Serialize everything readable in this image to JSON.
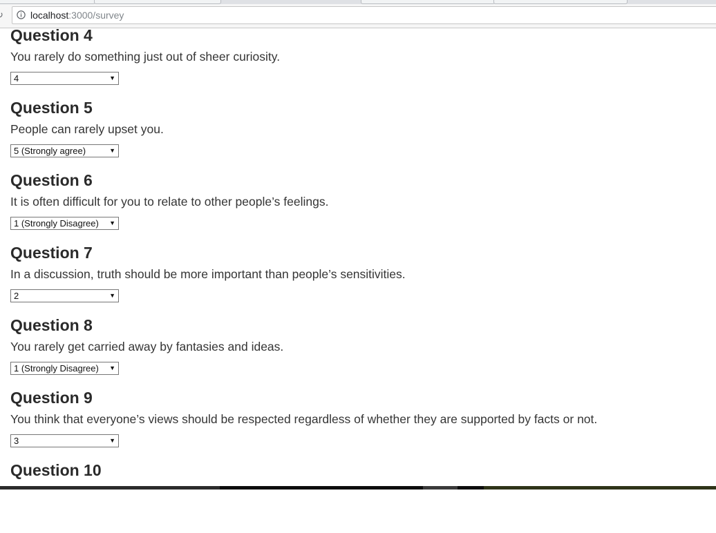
{
  "browser": {
    "url_host": "localhost",
    "url_path": ":3000/survey"
  },
  "questions": [
    {
      "title": "Question 4",
      "text": "You rarely do something just out of sheer curiosity.",
      "selected": "4"
    },
    {
      "title": "Question 5",
      "text": "People can rarely upset you.",
      "selected": "5 (Strongly agree)"
    },
    {
      "title": "Question 6",
      "text": "It is often difficult for you to relate to other people’s feelings.",
      "selected": "1 (Strongly Disagree)"
    },
    {
      "title": "Question 7",
      "text": "In a discussion, truth should be more important than people’s sensitivities.",
      "selected": "2"
    },
    {
      "title": "Question 8",
      "text": "You rarely get carried away by fantasies and ideas.",
      "selected": "1 (Strongly Disagree)"
    },
    {
      "title": "Question 9",
      "text": "You think that everyone’s views should be respected regardless of whether they are supported by facts or not.",
      "selected": "3"
    },
    {
      "title": "Question 10"
    }
  ],
  "icons": {
    "reload": "reload-icon",
    "info": "info-icon",
    "dropdown": "chevron-down-icon"
  }
}
